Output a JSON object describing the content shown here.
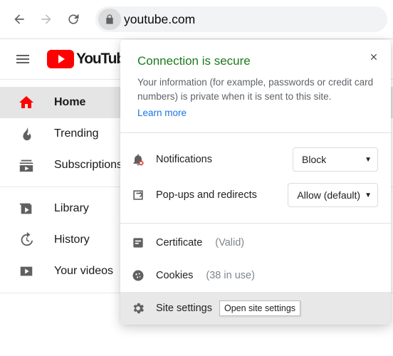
{
  "browser": {
    "url": "youtube.com"
  },
  "youtube": {
    "logo_text": "YouTube",
    "sidebar": {
      "group1": [
        {
          "label": "Home"
        },
        {
          "label": "Trending"
        },
        {
          "label": "Subscriptions"
        }
      ],
      "group2": [
        {
          "label": "Library"
        },
        {
          "label": "History"
        },
        {
          "label": "Your videos"
        }
      ]
    }
  },
  "popover": {
    "title": "Connection is secure",
    "body": "Your information (for example, passwords or credit card numbers) is private when it is sent to this site.",
    "learn": "Learn more",
    "permissions": [
      {
        "label": "Notifications",
        "value": "Block"
      },
      {
        "label": "Pop-ups and redirects",
        "value": "Allow (default)"
      }
    ],
    "info": {
      "cert_label": "Certificate",
      "cert_status": "(Valid)",
      "cookies_label": "Cookies",
      "cookies_status": "(38 in use)",
      "settings_label": "Site settings"
    },
    "tooltip": "Open site settings"
  }
}
